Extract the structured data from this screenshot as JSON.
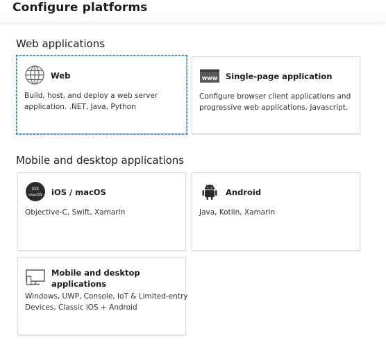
{
  "page": {
    "title": "Configure platforms"
  },
  "sections": {
    "web": {
      "title": "Web applications",
      "cards": {
        "web": {
          "icon": "globe-icon",
          "title": "Web",
          "description": "Build, host, and deploy a web server application. .NET, Java, Python"
        },
        "spa": {
          "icon": "browser-www-icon",
          "icon_text": "www",
          "title": "Single-page application",
          "description": "Configure browser client applications and progressive web applications. Javascript."
        }
      }
    },
    "mobile": {
      "title": "Mobile and desktop applications",
      "cards": {
        "ios": {
          "icon": "ios-macos-icon",
          "icon_text_top": "iOS",
          "icon_text_bottom": "macOS",
          "title": "iOS / macOS",
          "description": "Objective-C, Swift, Xamarin"
        },
        "android": {
          "icon": "android-icon",
          "title": "Android",
          "description": "Java, Kotlin, Xamarin"
        },
        "desktop": {
          "icon": "desktop-monitor-icon",
          "title": "Mobile and desktop applications",
          "description": "Windows, UWP, Console, IoT & Limited-entry Devices, Classic iOS + Android"
        }
      }
    }
  },
  "colors": {
    "focus_outline": "#0078d4",
    "card_border": "#dcdcdc",
    "text": "#1b1b1b"
  }
}
